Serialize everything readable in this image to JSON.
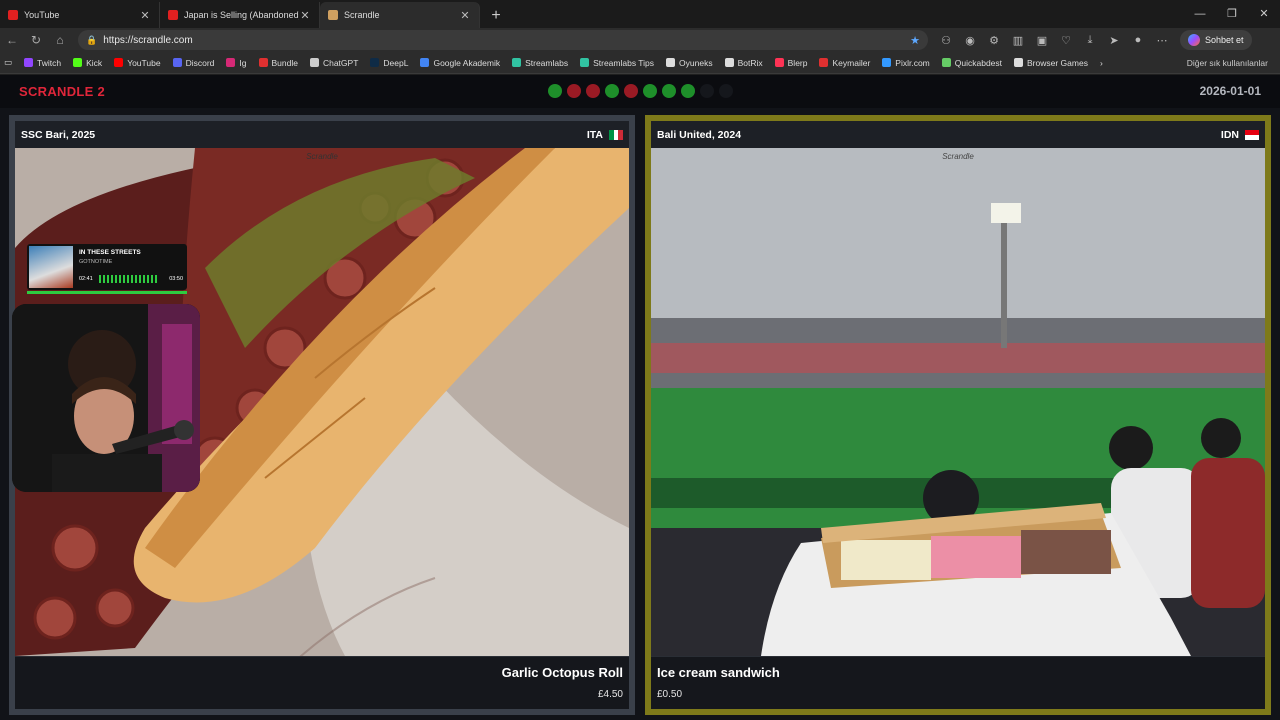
{
  "browser": {
    "tabs": [
      {
        "title": "YouTube",
        "color": "#e02020"
      },
      {
        "title": "Japan is Selling (Abandoned) Hou",
        "color": "#e02020"
      },
      {
        "title": "Scrandle",
        "color": "#d0a060"
      }
    ],
    "url": "https://scrandle.com",
    "copilot_label": "Sohbet et",
    "bookmarks": [
      {
        "label": "Twitch",
        "color": "#9146ff"
      },
      {
        "label": "Kick",
        "color": "#53fc18"
      },
      {
        "label": "YouTube",
        "color": "#ff0000"
      },
      {
        "label": "Discord",
        "color": "#5865f2"
      },
      {
        "label": "Ig",
        "color": "#d62976"
      },
      {
        "label": "Bundle",
        "color": "#e03030"
      },
      {
        "label": "ChatGPT",
        "color": "#cccccc"
      },
      {
        "label": "DeepL",
        "color": "#0f2b46"
      },
      {
        "label": "Google Akademik",
        "color": "#4285f4"
      },
      {
        "label": "Streamlabs",
        "color": "#31c3a2"
      },
      {
        "label": "Streamlabs Tips",
        "color": "#31c3a2"
      },
      {
        "label": "Oyuneks",
        "color": "#dddddd"
      },
      {
        "label": "BotRix",
        "color": "#dddddd"
      },
      {
        "label": "Blerp",
        "color": "#ff3355"
      },
      {
        "label": "Keymailer",
        "color": "#e03030"
      },
      {
        "label": "Pixlr.com",
        "color": "#3399ff"
      },
      {
        "label": "Quickabdest",
        "color": "#66cc66"
      },
      {
        "label": "Browser Games",
        "color": "#dddddd"
      }
    ],
    "bookmarks_more": "Diğer sık kullanılanlar"
  },
  "game": {
    "logo": "SCRANDLE 2",
    "date": "2026-01-01",
    "progress": [
      "green",
      "red",
      "red",
      "green",
      "red",
      "green",
      "green",
      "green",
      "empty",
      "empty"
    ],
    "colors": {
      "green": "#1e8f2a",
      "red": "#9a1a24",
      "empty": "#15171c",
      "selected_border": "#7e7a1a"
    }
  },
  "left": {
    "source": "SSC Bari, 2025",
    "country": "ITA",
    "watermark": "Scrandle",
    "name": "Garlic Octopus Roll",
    "price": "£4.50"
  },
  "right": {
    "source": "Bali United, 2024",
    "country": "IDN",
    "watermark": "Scrandle",
    "name": "Ice cream sandwich",
    "price": "£0.50"
  },
  "overlay": {
    "song": "IN THESE STREETS",
    "artist": "GOTNOTIME",
    "elapsed": "02:41",
    "duration": "03:50"
  }
}
